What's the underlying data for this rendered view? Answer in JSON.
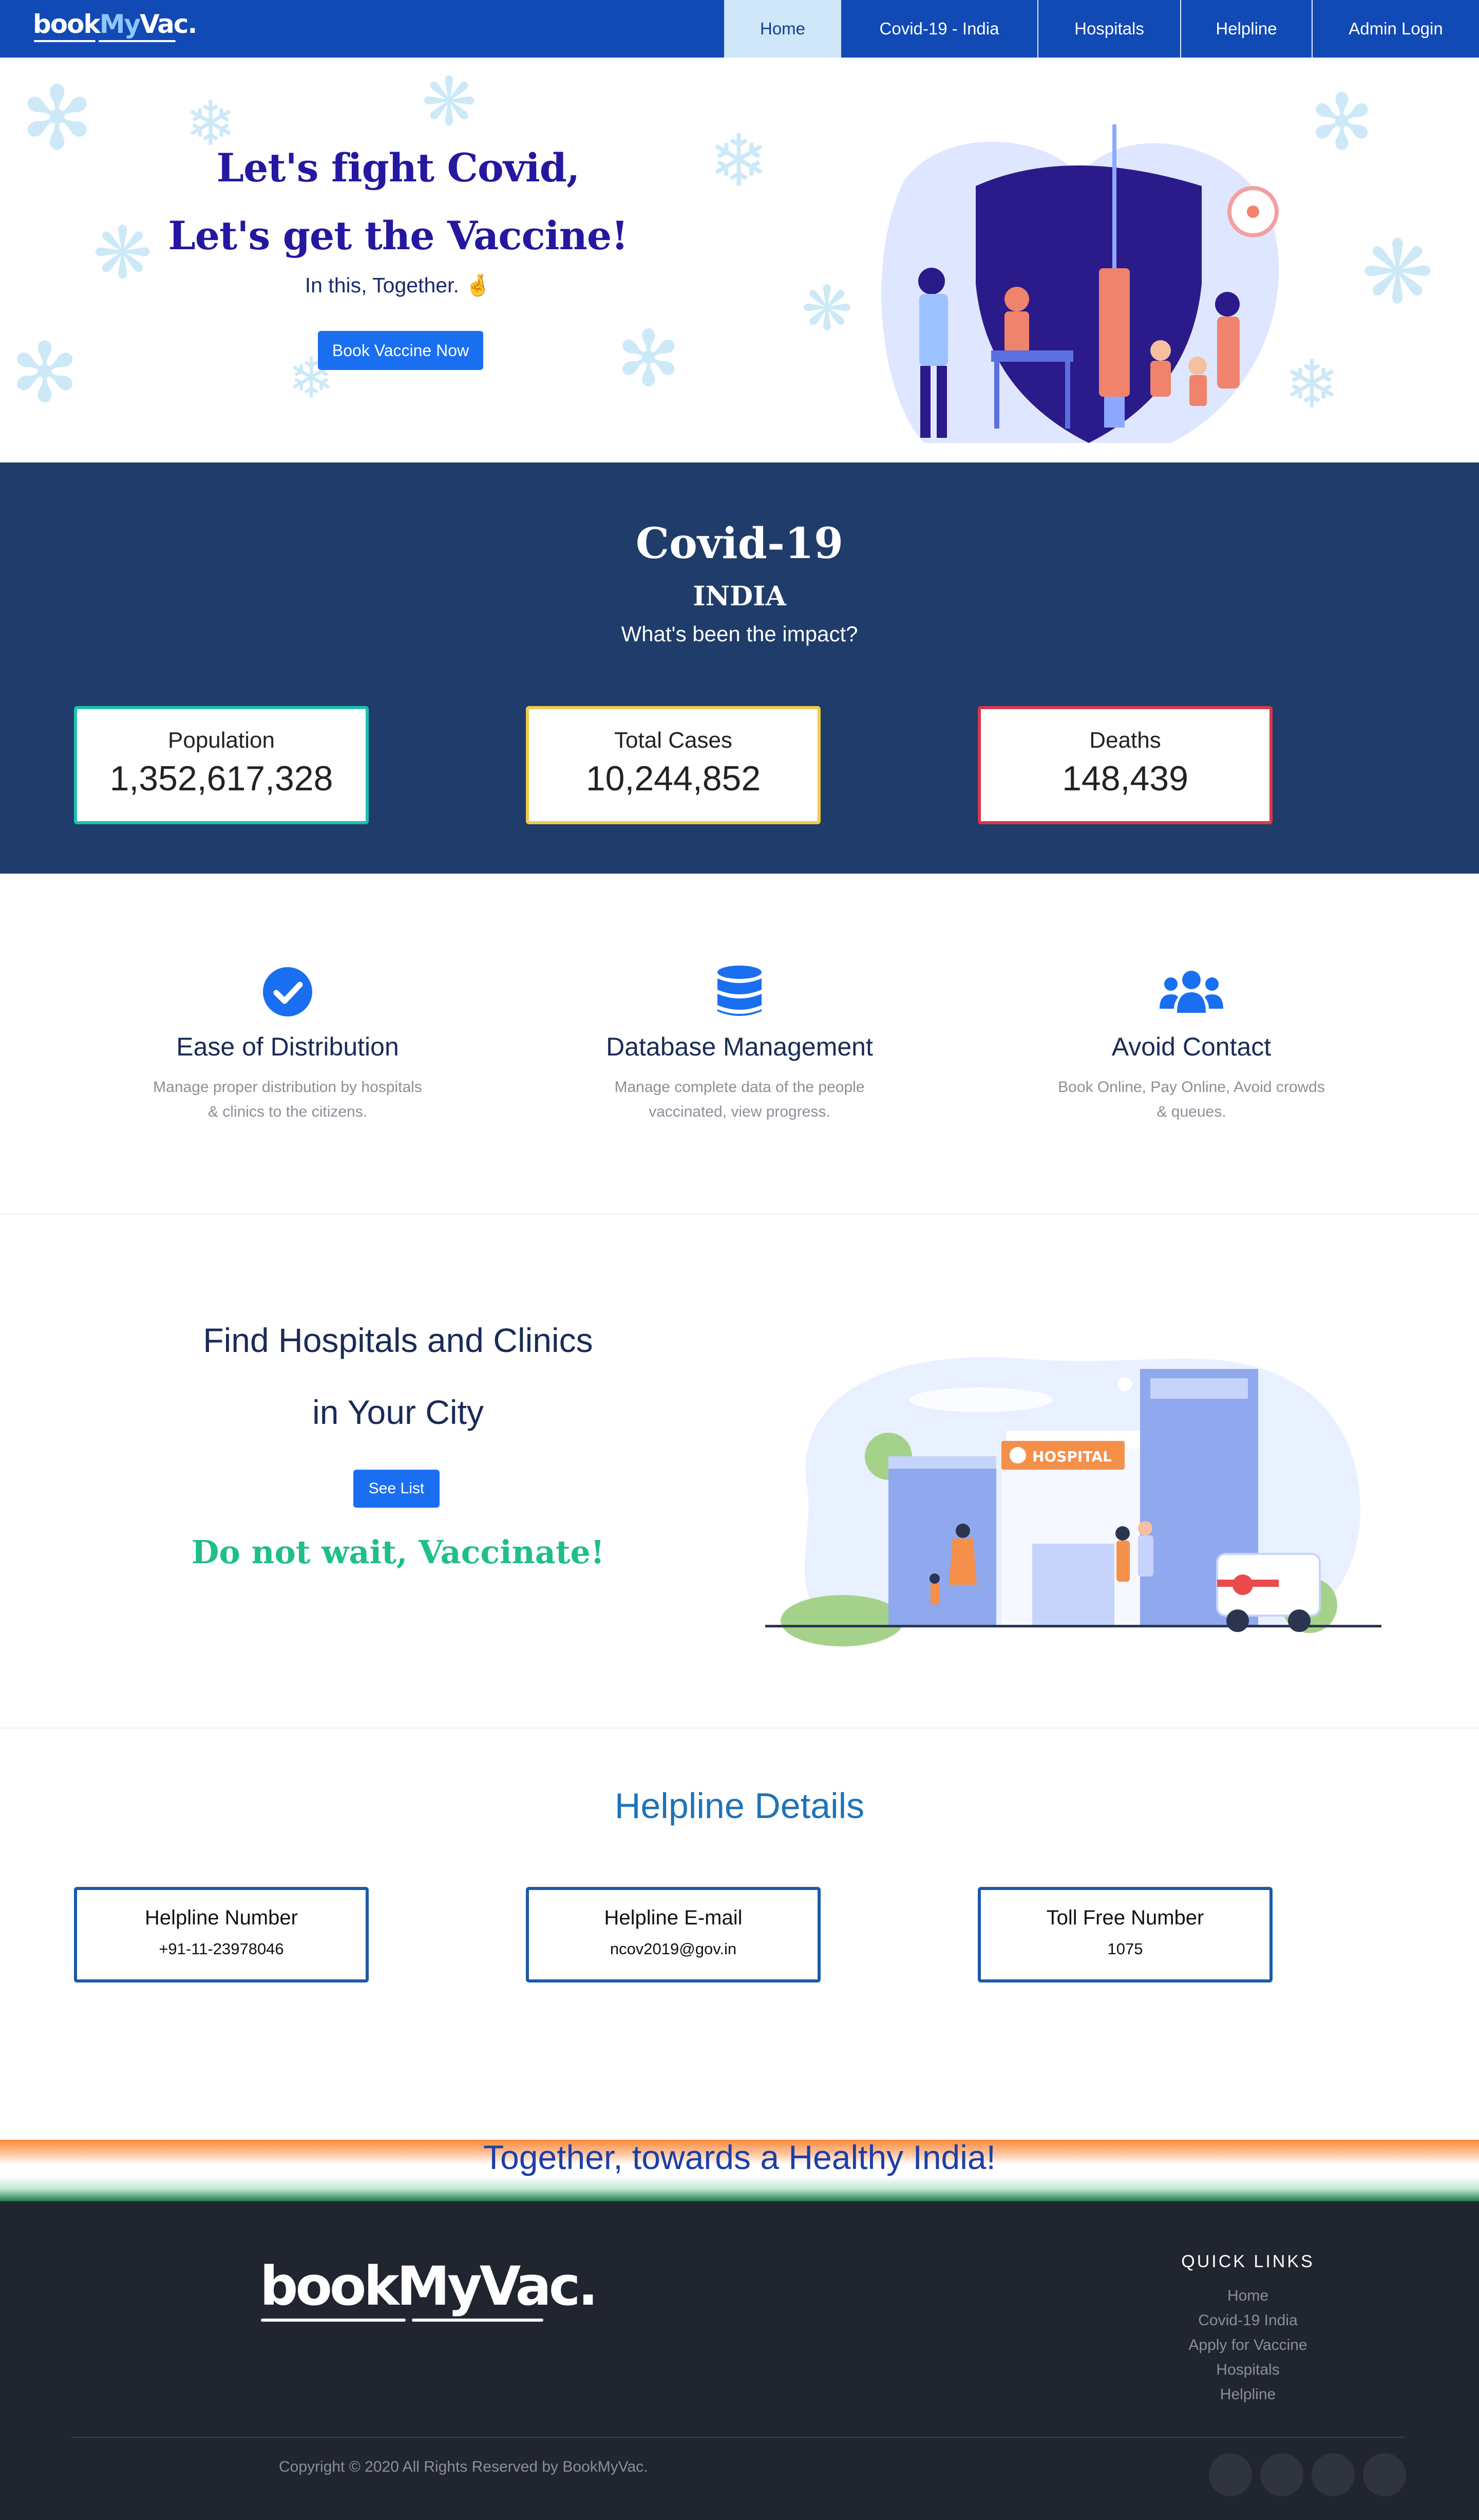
{
  "brand": {
    "logo_book": "book",
    "logo_my": "My",
    "logo_vac": "Vac.",
    "logo_full": "bookMyVac."
  },
  "nav": {
    "items": [
      {
        "label": "Home",
        "active": true
      },
      {
        "label": "Covid-19 - India"
      },
      {
        "label": "Hospitals"
      },
      {
        "label": "Helpline"
      },
      {
        "label": "Admin Login"
      }
    ]
  },
  "hero": {
    "line1": "Let's fight Covid,",
    "line2": "Let's get the Vaccine!",
    "subtitle": "In this, Together. 🤞",
    "cta": "Book Vaccine Now"
  },
  "stats": {
    "title": "Covid-19",
    "country": "INDIA",
    "question": "What's been the impact?",
    "cards": [
      {
        "label": "Population",
        "value": "1,352,617,328",
        "border": "#1fbfae"
      },
      {
        "label": "Total Cases",
        "value": "10,244,852",
        "border": "#f2c94c"
      },
      {
        "label": "Deaths",
        "value": "148,439",
        "border": "#d9364a"
      }
    ]
  },
  "features": [
    {
      "icon": "check-circle-icon",
      "title": "Ease of Distribution",
      "desc1": "Manage proper distribution by hospitals",
      "desc2": "& clinics to the citizens."
    },
    {
      "icon": "database-icon",
      "title": "Database Management",
      "desc1": "Manage complete data of the people",
      "desc2": "vaccinated, view progress."
    },
    {
      "icon": "users-icon",
      "title": "Avoid Contact",
      "desc1": "Book Online, Pay Online, Avoid crowds",
      "desc2": "& queues."
    }
  ],
  "hospitals": {
    "line1": "Find Hospitals and Clinics",
    "line2": "in Your City",
    "button": "See List",
    "tagline": "Do not wait, Vaccinate!",
    "sign": "HOSPITAL"
  },
  "helpline": {
    "title": "Helpline Details",
    "cards": [
      {
        "label": "Helpline Number",
        "value": "+91-11-23978046"
      },
      {
        "label": "Helpline E-mail",
        "value": "ncov2019@gov.in"
      },
      {
        "label": "Toll Free Number",
        "value": "1075"
      }
    ]
  },
  "band": {
    "text": "Together, towards a Healthy India!"
  },
  "footer": {
    "quick_links_title": "QUICK LINKS",
    "links": [
      "Home",
      "Covid-19 India",
      "Apply for Vaccine",
      "Hospitals",
      "Helpline"
    ],
    "copyright": "Copyright © 2020 All Rights Reserved by BookMyVac."
  },
  "colors": {
    "nav_bg": "#1149b5",
    "stats_bg": "#1f3c6a",
    "accent_blue": "#1a6ff0",
    "hero_heading": "#2418a0",
    "tagline_green": "#1fbe8a",
    "footer_bg": "#212530"
  }
}
